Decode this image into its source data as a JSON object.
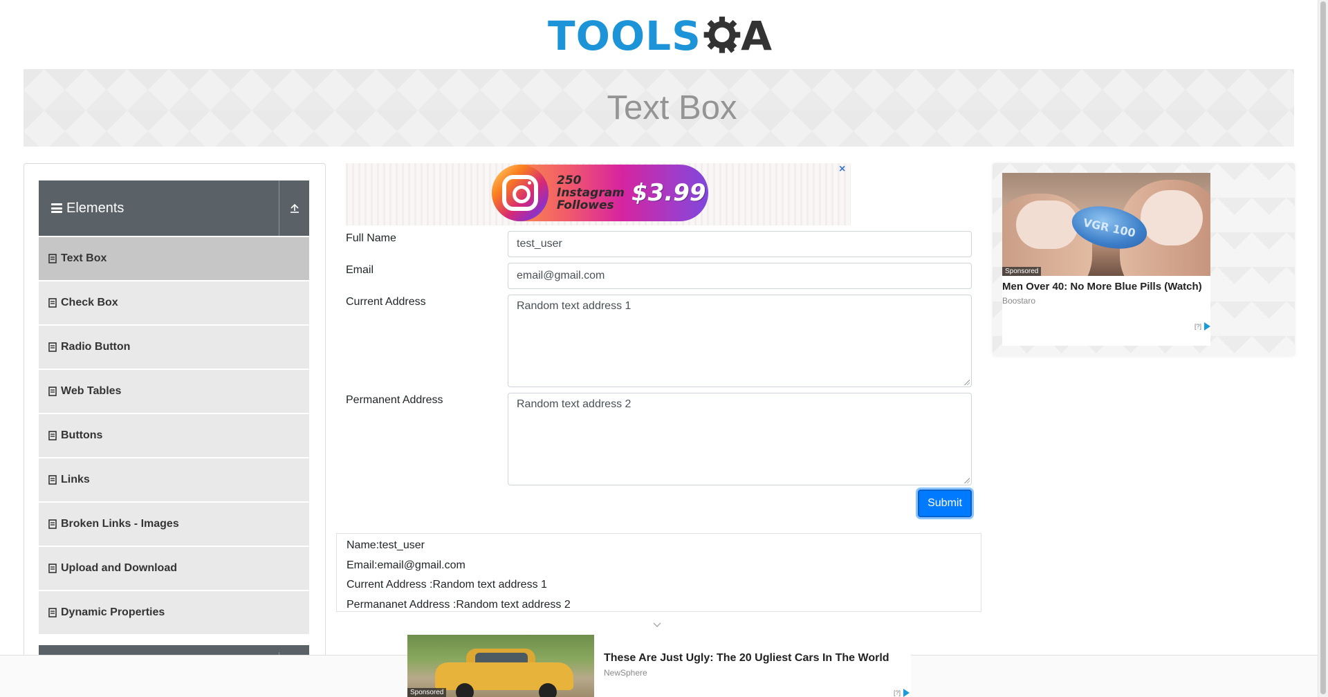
{
  "header": {
    "logo_text": "TOOLS",
    "logo_suffix": "A"
  },
  "banner": {
    "title": "Text Box"
  },
  "sidebar": {
    "group_title": "Elements",
    "items": [
      {
        "label": "Text Box",
        "active": true
      },
      {
        "label": "Check Box",
        "active": false
      },
      {
        "label": "Radio Button",
        "active": false
      },
      {
        "label": "Web Tables",
        "active": false
      },
      {
        "label": "Buttons",
        "active": false
      },
      {
        "label": "Links",
        "active": false
      },
      {
        "label": "Broken Links - Images",
        "active": false
      },
      {
        "label": "Upload and Download",
        "active": false
      },
      {
        "label": "Dynamic Properties",
        "active": false
      }
    ]
  },
  "top_ad": {
    "text": "250 Instagram Followes",
    "price": "$3.99",
    "close": "×"
  },
  "form": {
    "full_name_label": "Full Name",
    "full_name_value": "test_user",
    "email_label": "Email",
    "email_value": "email@gmail.com",
    "current_address_label": "Current Address",
    "current_address_value": "Random text address 1",
    "permanent_address_label": "Permanent Address",
    "permanent_address_value": "Random text address 2",
    "submit_label": "Submit"
  },
  "output": {
    "name": "Name:test_user",
    "email": "Email:email@gmail.com",
    "current_address": "Current Address :Random text address 1",
    "permanent_address": "Permananet Address :Random text address 2"
  },
  "side_ad": {
    "sponsored": "Sponsored",
    "pill_text": "VGR 100",
    "title": "Men Over 40: No More Blue Pills (Watch)",
    "source": "Boostaro",
    "adchoice": "[?]"
  },
  "bottom_ad": {
    "sponsored": "Sponsored",
    "title": "These Are Just Ugly: The 20 Ugliest Cars In The World",
    "source": "NewSphere",
    "adchoice": "[?]"
  },
  "colors": {
    "primary": "#007bff",
    "logo_blue": "#1d94d7",
    "sidebar_header": "#5a6268",
    "menu_active": "#c6c6c6"
  }
}
